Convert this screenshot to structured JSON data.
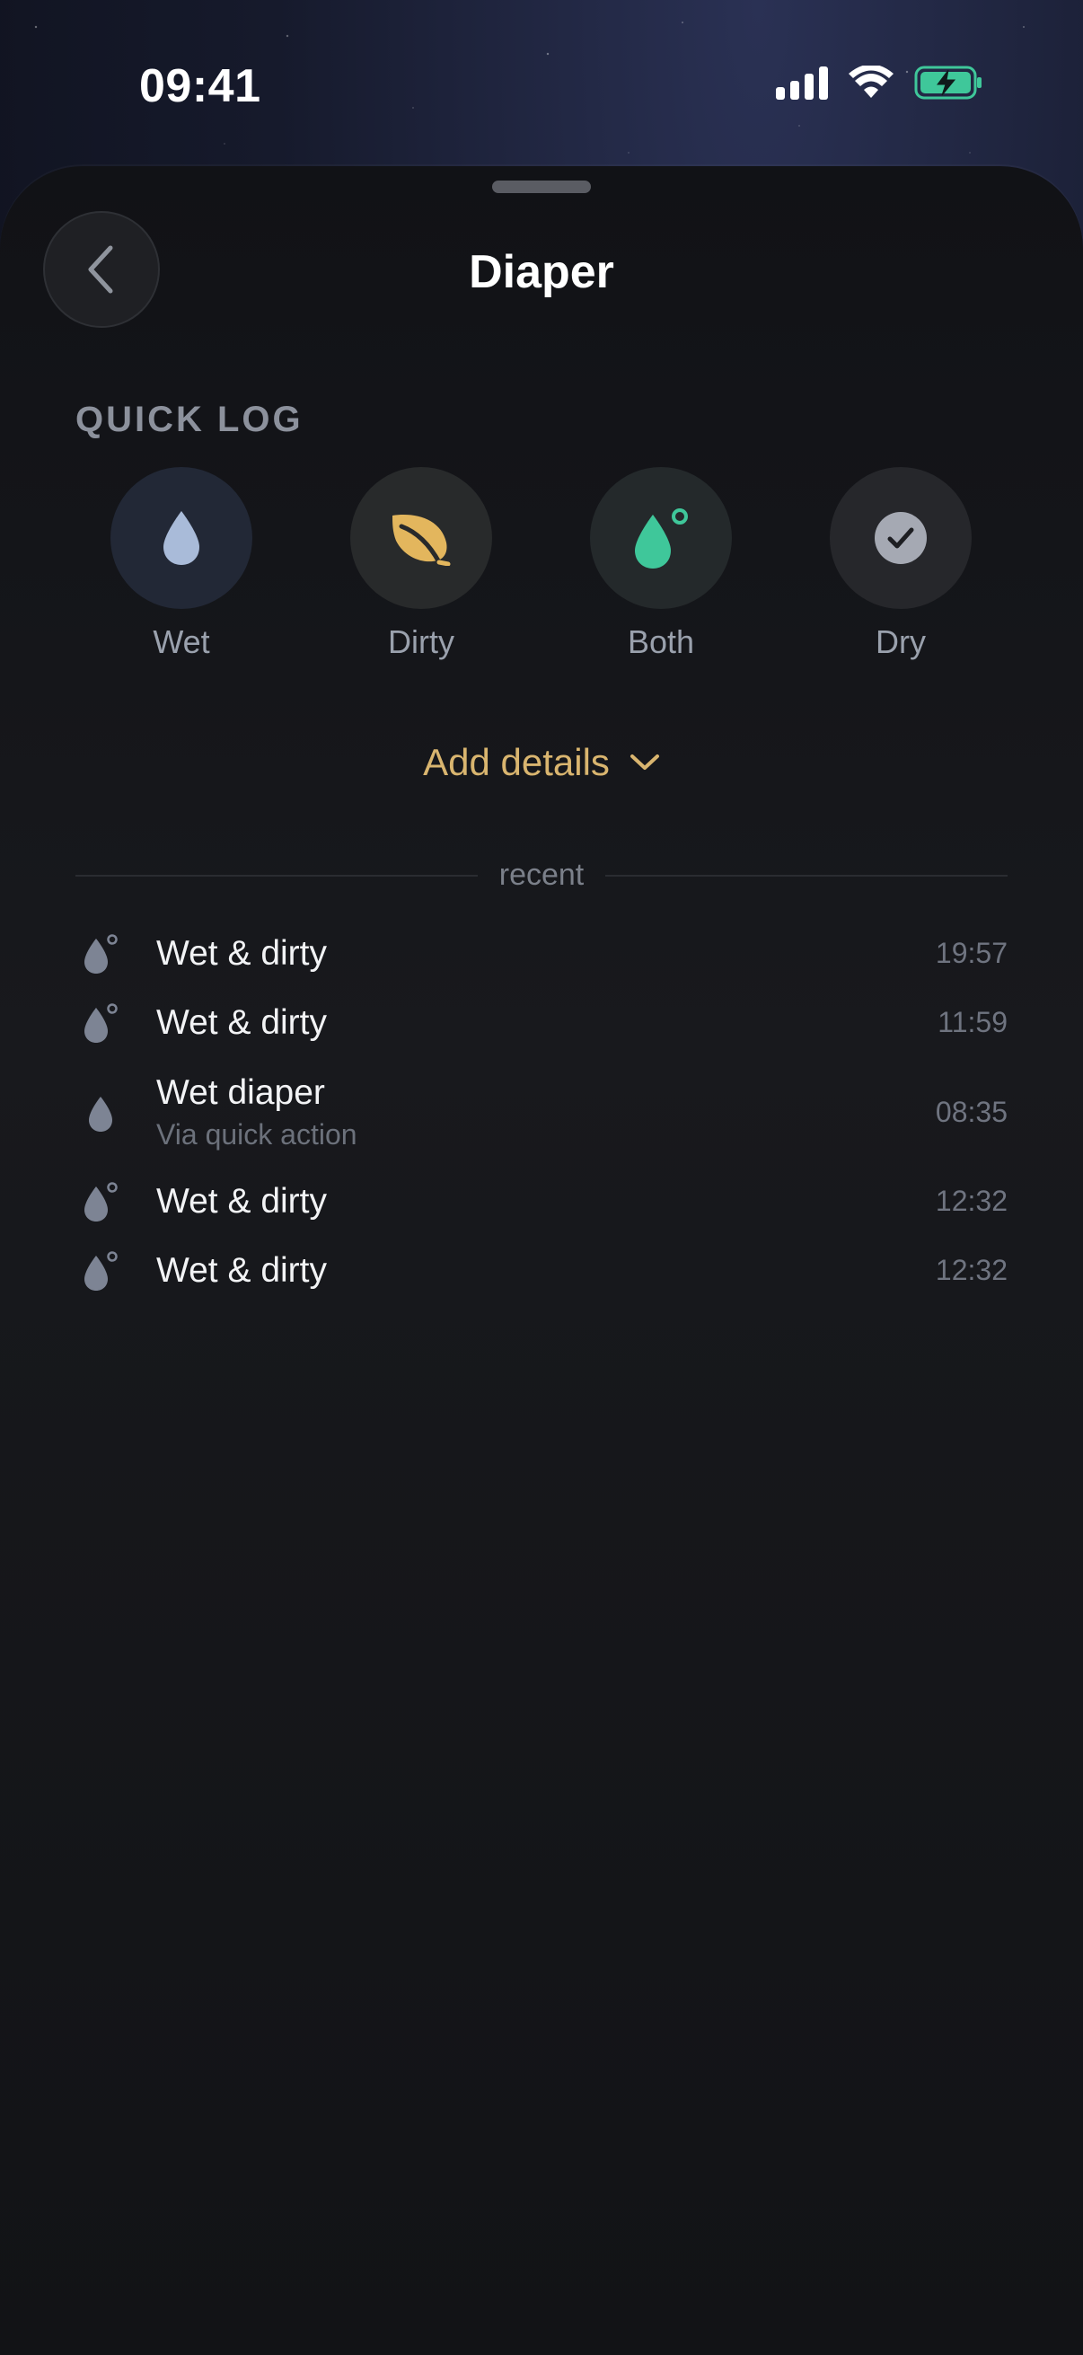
{
  "status_bar": {
    "time": "09:41",
    "battery_color": "#3fc79a"
  },
  "sheet": {
    "title": "Diaper",
    "back_icon": "chevron-left-icon"
  },
  "quick_log": {
    "label": "QUICK LOG",
    "items": [
      {
        "label": "Wet",
        "icon": "droplet-icon",
        "color": "#a9bbd9",
        "bg": "#232a3a"
      },
      {
        "label": "Dirty",
        "icon": "leaf-icon",
        "color": "#e3b65d",
        "bg": "#2a2b2c"
      },
      {
        "label": "Both",
        "icon": "droplet-dot-icon",
        "color": "#3fc79a",
        "bg": "#23292b"
      },
      {
        "label": "Dry",
        "icon": "check-circle-icon",
        "color": "#a5a9b3",
        "bg": "#26272b"
      }
    ]
  },
  "add_details": {
    "label": "Add details",
    "color": "#d9b56f"
  },
  "recent": {
    "label": "recent",
    "items": [
      {
        "title": "Wet & dirty",
        "subtitle": "",
        "time": "19:57",
        "icon": "droplet-dot-icon"
      },
      {
        "title": "Wet & dirty",
        "subtitle": "",
        "time": "11:59",
        "icon": "droplet-dot-icon"
      },
      {
        "title": "Wet diaper",
        "subtitle": "Via quick action",
        "time": "08:35",
        "icon": "droplet-icon"
      },
      {
        "title": "Wet & dirty",
        "subtitle": "",
        "time": "12:32",
        "icon": "droplet-dot-icon"
      },
      {
        "title": "Wet & dirty",
        "subtitle": "",
        "time": "12:32",
        "icon": "droplet-dot-icon"
      }
    ]
  }
}
